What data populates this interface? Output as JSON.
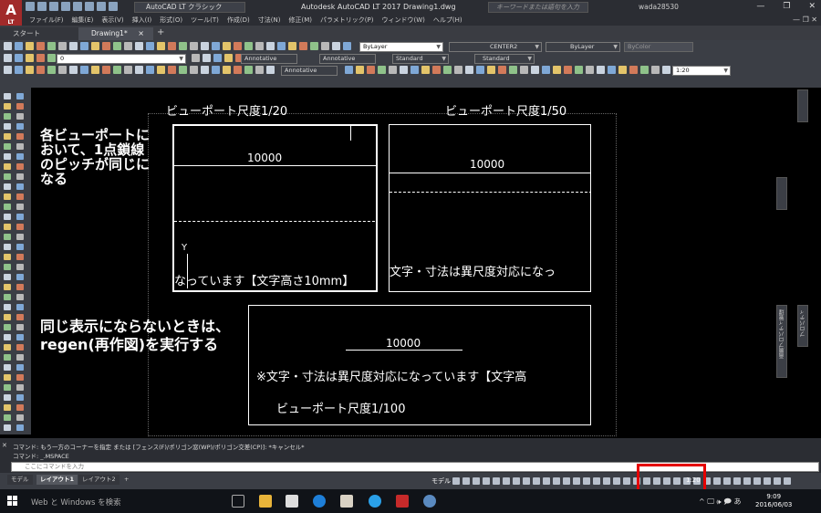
{
  "window": {
    "app_logo": "A",
    "app_logo_sub": "LT",
    "workspace": "AutoCAD LT クラシック",
    "title": "Autodesk AutoCAD LT 2017    Drawing1.dwg",
    "search_placeholder": "キーワードまたは語句を入力",
    "user": "wada28530",
    "minimize": "—",
    "restore": "❐",
    "close": "✕"
  },
  "menu": {
    "items": [
      "ファイル(F)",
      "編集(E)",
      "表示(V)",
      "挿入(I)",
      "形式(O)",
      "ツール(T)",
      "作成(D)",
      "寸法(N)",
      "修正(M)",
      "パラメトリック(P)",
      "ウィンドウ(W)",
      "ヘルプ(H)"
    ],
    "controls": "— ❐ ✕"
  },
  "tabs": {
    "start": "スタート",
    "drawing": "Drawing1*",
    "close": "×",
    "add": "+"
  },
  "toolbar": {
    "layer_value": "ByLayer",
    "linetype_value": "CENTER2",
    "lineweight_value": "ByLayer",
    "color_value": "ByColor",
    "layer_name": "0",
    "annotative_1": "Annotative",
    "annotative_2": "Annotative",
    "annotative_3": "Annotative",
    "textstyle": "Standard",
    "dimstyle": "Standard",
    "scale_value": "1:20"
  },
  "drawing": {
    "vp1_title": "ビューポート尺度1/20",
    "vp2_title": "ビューポート尺度1/50",
    "vp3_title": "ビューポート尺度1/100",
    "note1_lines": [
      "各ビューポートに",
      "おいて、1点鎖線",
      "のピッチが同じに",
      "なる"
    ],
    "note2_lines": [
      "同じ表示にならないときは、",
      "regen(再作図)を実行する"
    ],
    "dim_value": "10000",
    "vp1_text": "なっています【文字高さ10mm】",
    "vp2_text": "文字・寸法は異尺度対応になっ",
    "vp3_text": "※文字・寸法は異尺度対応になっています【文字高",
    "ucs_y": "Y"
  },
  "palette": {
    "label_1": "画層プロパティ管理",
    "label_2": "プロパティ"
  },
  "command": {
    "line1": "コマンド: もう一方のコーナーを指定 または [フェンス(F)/ポリゴン窓(WP)/ポリゴン交差(CP)]: *キャンセル*",
    "line2": "コマンド: _.MSPACE",
    "placeholder": "ここにコマンドを入力",
    "close": "✕"
  },
  "statusbar": {
    "tabs": [
      "モデル",
      "レイアウト1",
      "レイアウト2"
    ],
    "add": "+",
    "model_label": "モデル",
    "scale": "1:20"
  },
  "taskbar": {
    "search": "Web と Windows を検索",
    "tray": "^ 🖵 🕪 🗩 あ",
    "time": "9:09",
    "date": "2016/06/03"
  },
  "colors": {
    "accent_red": "#e60000",
    "autocad_red": "#a12a2a",
    "toolbar_bg": "#3b3e45"
  }
}
